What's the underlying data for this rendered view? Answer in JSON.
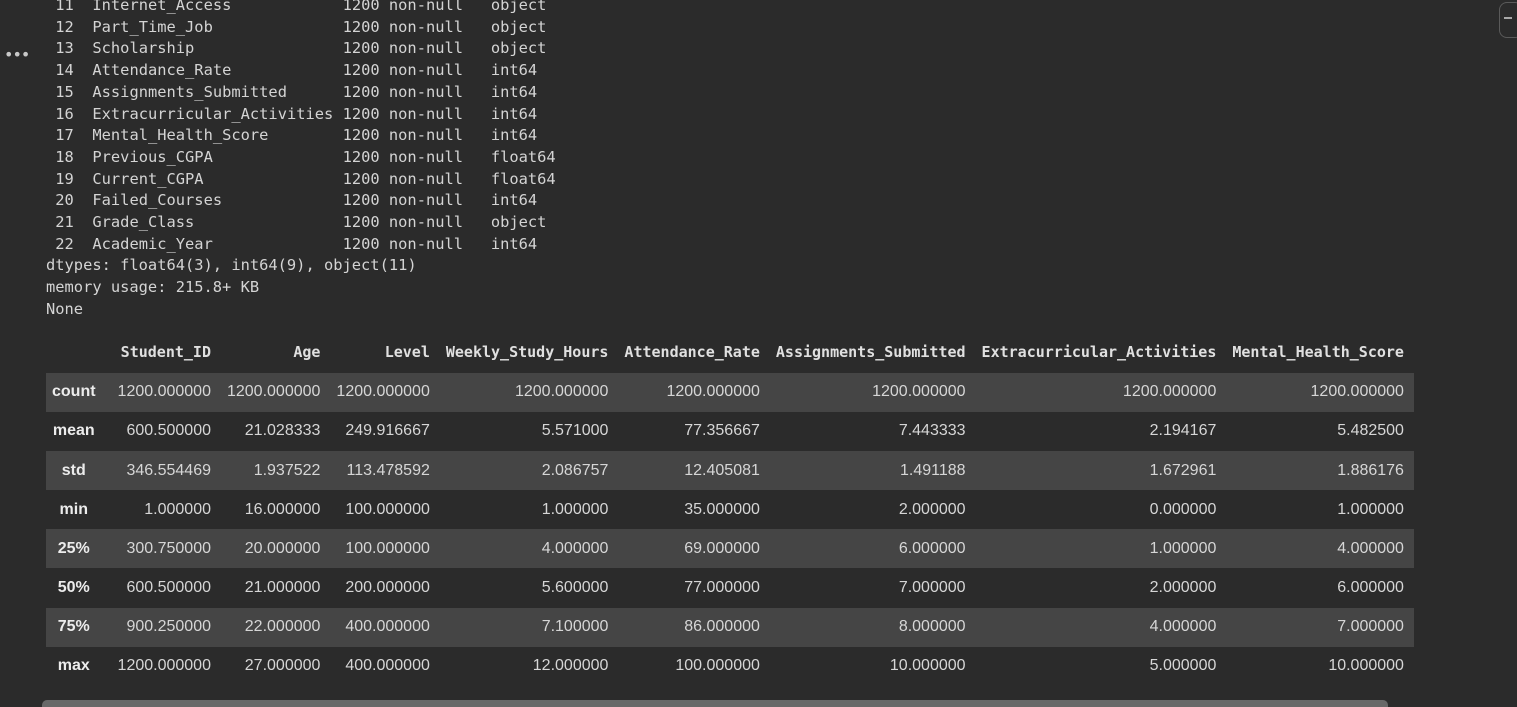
{
  "colors": {
    "background": "#2b2b2b",
    "row_stripe": "#454545",
    "text": "#d4d4d4",
    "scrollbar": "#686868"
  },
  "icons": {
    "more": "more-horizontal-icon",
    "corner": "collapse-icon"
  },
  "info": {
    "columns": [
      {
        "idx": "11",
        "name": "Internet_Access",
        "count": "1200 non-null",
        "dtype": "object"
      },
      {
        "idx": "12",
        "name": "Part_Time_Job",
        "count": "1200 non-null",
        "dtype": "object"
      },
      {
        "idx": "13",
        "name": "Scholarship",
        "count": "1200 non-null",
        "dtype": "object"
      },
      {
        "idx": "14",
        "name": "Attendance_Rate",
        "count": "1200 non-null",
        "dtype": "int64"
      },
      {
        "idx": "15",
        "name": "Assignments_Submitted",
        "count": "1200 non-null",
        "dtype": "int64"
      },
      {
        "idx": "16",
        "name": "Extracurricular_Activities",
        "count": "1200 non-null",
        "dtype": "int64"
      },
      {
        "idx": "17",
        "name": "Mental_Health_Score",
        "count": "1200 non-null",
        "dtype": "int64"
      },
      {
        "idx": "18",
        "name": "Previous_CGPA",
        "count": "1200 non-null",
        "dtype": "float64"
      },
      {
        "idx": "19",
        "name": "Current_CGPA",
        "count": "1200 non-null",
        "dtype": "float64"
      },
      {
        "idx": "20",
        "name": "Failed_Courses",
        "count": "1200 non-null",
        "dtype": "int64"
      },
      {
        "idx": "21",
        "name": "Grade_Class",
        "count": "1200 non-null",
        "dtype": "object"
      },
      {
        "idx": "22",
        "name": "Academic_Year",
        "count": "1200 non-null",
        "dtype": "int64"
      }
    ],
    "dtypes_line": "dtypes: float64(3), int64(9), object(11)",
    "memory_line": "memory usage: 215.8+ KB",
    "return_line": "None"
  },
  "describe": {
    "columns": [
      "Student_ID",
      "Age",
      "Level",
      "Weekly_Study_Hours",
      "Attendance_Rate",
      "Assignments_Submitted",
      "Extracurricular_Activities",
      "Mental_Health_Score"
    ],
    "rows": [
      {
        "label": "count",
        "values": [
          "1200.000000",
          "1200.000000",
          "1200.000000",
          "1200.000000",
          "1200.000000",
          "1200.000000",
          "1200.000000",
          "1200.000000"
        ]
      },
      {
        "label": "mean",
        "values": [
          "600.500000",
          "21.028333",
          "249.916667",
          "5.571000",
          "77.356667",
          "7.443333",
          "2.194167",
          "5.482500"
        ]
      },
      {
        "label": "std",
        "values": [
          "346.554469",
          "1.937522",
          "113.478592",
          "2.086757",
          "12.405081",
          "1.491188",
          "1.672961",
          "1.886176"
        ]
      },
      {
        "label": "min",
        "values": [
          "1.000000",
          "16.000000",
          "100.000000",
          "1.000000",
          "35.000000",
          "2.000000",
          "0.000000",
          "1.000000"
        ]
      },
      {
        "label": "25%",
        "values": [
          "300.750000",
          "20.000000",
          "100.000000",
          "4.000000",
          "69.000000",
          "6.000000",
          "1.000000",
          "4.000000"
        ]
      },
      {
        "label": "50%",
        "values": [
          "600.500000",
          "21.000000",
          "200.000000",
          "5.600000",
          "77.000000",
          "7.000000",
          "2.000000",
          "6.000000"
        ]
      },
      {
        "label": "75%",
        "values": [
          "900.250000",
          "22.000000",
          "400.000000",
          "7.100000",
          "86.000000",
          "8.000000",
          "4.000000",
          "7.000000"
        ]
      },
      {
        "label": "max",
        "values": [
          "1200.000000",
          "27.000000",
          "400.000000",
          "12.000000",
          "100.000000",
          "10.000000",
          "5.000000",
          "10.000000"
        ]
      }
    ]
  }
}
